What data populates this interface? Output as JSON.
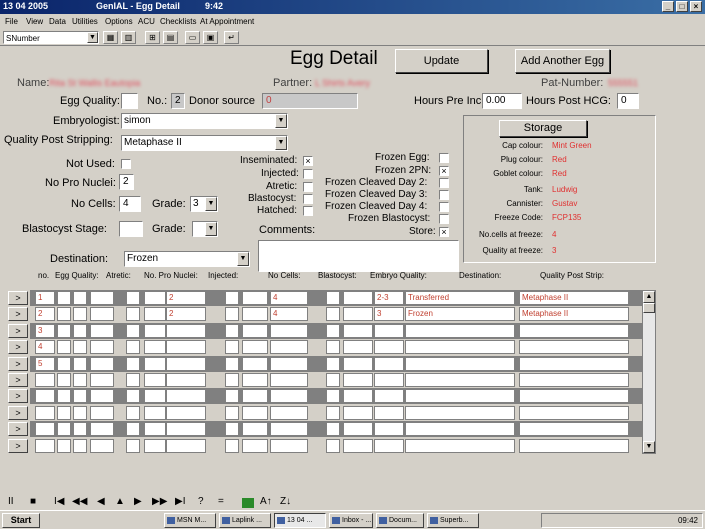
{
  "titlebar": {
    "date": "13 04 2005",
    "app": "GenIAL - Egg Detail",
    "time": "9:42"
  },
  "menu": [
    "File",
    "View",
    "Data",
    "Utilities",
    "Options",
    "ACU",
    "Checklists",
    "At Appointment"
  ],
  "toolbar": {
    "field_combo": "SNumber"
  },
  "form": {
    "title": "Egg Detail",
    "update_label": "Update",
    "add_another_label": "Add Another Egg",
    "name_label": "Name:",
    "name_value": "Rita St Wallis Eautopia",
    "partner_label": "Partner:",
    "partner_value": "L Shirts Avery",
    "pat_number_label": "Pat-Number:",
    "pat_number_value": "555551",
    "egg_quality_label": "Egg Quality:",
    "egg_quality_value": "",
    "no_label": "No.:",
    "no_value": "2",
    "donor_source_label": "Donor source",
    "donor_source_value": "0",
    "hours_pre_inc_label": "Hours Pre Inc:",
    "hours_pre_inc_value": "0.00",
    "hours_post_hcg_label": "Hours Post HCG:",
    "hours_post_hcg_value": "0",
    "embryologist_label": "Embryologist:",
    "embryologist_value": "simon",
    "quality_post_stripping_label": "Quality Post Stripping:",
    "quality_post_stripping_value": "Metaphase II",
    "not_used_label": "Not Used:",
    "no_pro_nuclei_label": "No Pro Nuclei:",
    "no_pro_nuclei_value": "2",
    "no_cells_label": "No Cells:",
    "no_cells_value": "4",
    "grade_label": "Grade:",
    "grade_value": "3",
    "blastocyst_stage_label": "Blastocyst Stage:",
    "blastocyst_stage_value": "",
    "grade2_label": "Grade:",
    "grade2_value": "",
    "destination_label": "Destination:",
    "destination_value": "Frozen",
    "comments_label": "Comments:",
    "comments_value": "",
    "checks_mid": [
      {
        "label": "Inseminated:",
        "checked": true
      },
      {
        "label": "Injected:",
        "checked": false
      },
      {
        "label": "Atretic:",
        "checked": false
      },
      {
        "label": "Blastocyst:",
        "checked": false
      },
      {
        "label": "Hatched:",
        "checked": false
      }
    ],
    "checks_right": [
      {
        "label": "Frozen Egg:",
        "checked": false
      },
      {
        "label": "Frozen 2PN:",
        "checked": true
      },
      {
        "label": "Frozen Cleaved Day 2:",
        "checked": false
      },
      {
        "label": "Frozen Cleaved Day 3:",
        "checked": false
      },
      {
        "label": "Frozen Cleaved Day 4:",
        "checked": false
      },
      {
        "label": "Frozen Blastocyst:",
        "checked": false
      },
      {
        "label": "Store:",
        "checked": true
      }
    ]
  },
  "storage": {
    "button_label": "Storage",
    "rows": [
      {
        "label": "Cap colour:",
        "value": "Mint Green"
      },
      {
        "label": "Plug colour:",
        "value": "Red"
      },
      {
        "label": "Goblet colour:",
        "value": "Red"
      },
      {
        "label": "Tank:",
        "value": "Ludwig"
      },
      {
        "label": "Cannister:",
        "value": "Gustav"
      },
      {
        "label": "Freeze Code:",
        "value": "FCP135"
      },
      {
        "label": "No.cells at freeze:",
        "value": "4"
      },
      {
        "label": "Quality at freeze:",
        "value": "3"
      }
    ]
  },
  "table": {
    "headers": [
      "no.",
      "Egg Quality:",
      "Atretic:",
      "No. Pro Nuclei:",
      "Injected:",
      "No Cells:",
      "Blastocyst:",
      "Embryo Quality:",
      "Destination:",
      "Quality Post Strip:"
    ],
    "rows": [
      {
        "no": "1",
        "pn": "2",
        "cells": "4",
        "eq": "2-3",
        "dest": "Transferred",
        "qps": "Metaphase II"
      },
      {
        "no": "2",
        "pn": "2",
        "cells": "4",
        "eq": "3",
        "dest": "Frozen",
        "qps": "Metaphase II"
      },
      {
        "no": "3",
        "pn": "",
        "cells": "",
        "eq": "",
        "dest": "",
        "qps": ""
      },
      {
        "no": "4",
        "pn": "",
        "cells": "",
        "eq": "",
        "dest": "",
        "qps": ""
      },
      {
        "no": "5",
        "pn": "",
        "cells": "",
        "eq": "",
        "dest": "",
        "qps": ""
      },
      {
        "no": "",
        "pn": "",
        "cells": "",
        "eq": "",
        "dest": "",
        "qps": ""
      },
      {
        "no": "",
        "pn": "",
        "cells": "",
        "eq": "",
        "dest": "",
        "qps": ""
      },
      {
        "no": "",
        "pn": "",
        "cells": "",
        "eq": "",
        "dest": "",
        "qps": ""
      },
      {
        "no": "",
        "pn": "",
        "cells": "",
        "eq": "",
        "dest": "",
        "qps": ""
      },
      {
        "no": "",
        "pn": "",
        "cells": "",
        "eq": "",
        "dest": "",
        "qps": ""
      }
    ],
    "row_button_label": ">"
  },
  "navbar": [
    "II",
    "■",
    "I◀",
    "◀◀",
    "◀",
    "▲",
    "▶",
    "▶▶",
    "▶I",
    "?",
    "=",
    "A↑",
    "Z↓"
  ],
  "taskbar": {
    "start": "Start",
    "items": [
      "MSN M...",
      "Laplink ...",
      "13 04 ...",
      "Inbox - ...",
      "Docum...",
      "Superb..."
    ],
    "clock": "09:42"
  }
}
